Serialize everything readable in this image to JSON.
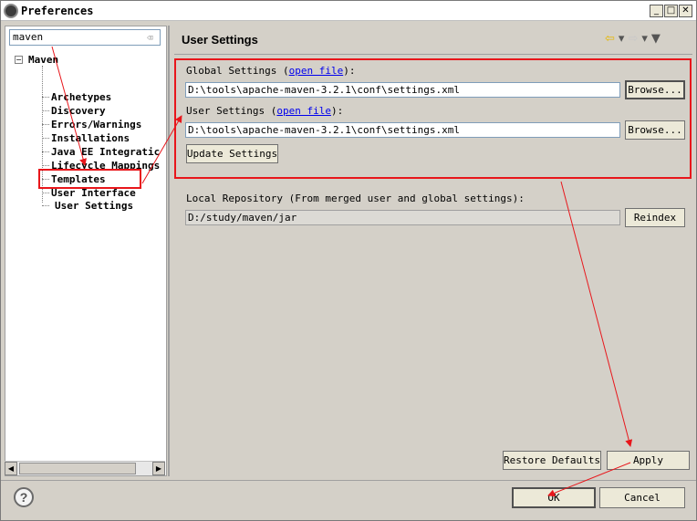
{
  "window": {
    "title": "Preferences",
    "minimize_icon": "minimize-icon",
    "maximize_icon": "maximize-icon",
    "close_icon": "close-icon",
    "min_glyph": "_",
    "max_glyph": "□",
    "close_glyph": "✕"
  },
  "sidebar": {
    "filter_value": "maven",
    "tree_root": "Maven",
    "collapse_glyph": "−",
    "items": [
      {
        "label": "Archetypes"
      },
      {
        "label": "Discovery"
      },
      {
        "label": "Errors/Warnings"
      },
      {
        "label": "Installations"
      },
      {
        "label": "Java EE Integratic"
      },
      {
        "label": "Lifecycle Mappings"
      },
      {
        "label": "Templates"
      },
      {
        "label": "User Interface"
      },
      {
        "label": "User Settings"
      }
    ],
    "scroll_left_glyph": "◀",
    "scroll_right_glyph": "▶"
  },
  "main": {
    "title": "User Settings",
    "nav": {
      "back": "⇦",
      "back_menu": "▾",
      "forward": "⇨",
      "forward_menu": "▾",
      "view_menu": "▼"
    },
    "global_settings": {
      "label_prefix": "Global Settings (",
      "link": "open file",
      "label_suffix": "):",
      "path": "D:\\tools\\apache-maven-3.2.1\\conf\\settings.xml",
      "browse": "Browse..."
    },
    "user_settings": {
      "label_prefix": "User Settings (",
      "link": "open file",
      "label_suffix": "):",
      "path": "D:\\tools\\apache-maven-3.2.1\\conf\\settings.xml",
      "browse": "Browse..."
    },
    "update_button": "Update Settings",
    "local_repo": {
      "label": "Local Repository (From merged user and global settings):",
      "path": "D:/study/maven/jar",
      "reindex": "Reindex"
    },
    "restore_defaults": "Restore Defaults",
    "apply": "Apply"
  },
  "footer": {
    "help": "?",
    "ok": "OK",
    "cancel": "Cancel"
  },
  "colors": {
    "annotation_red": "#e8161b",
    "link_blue": "#0000ee",
    "window_bg": "#d4d0c8"
  }
}
